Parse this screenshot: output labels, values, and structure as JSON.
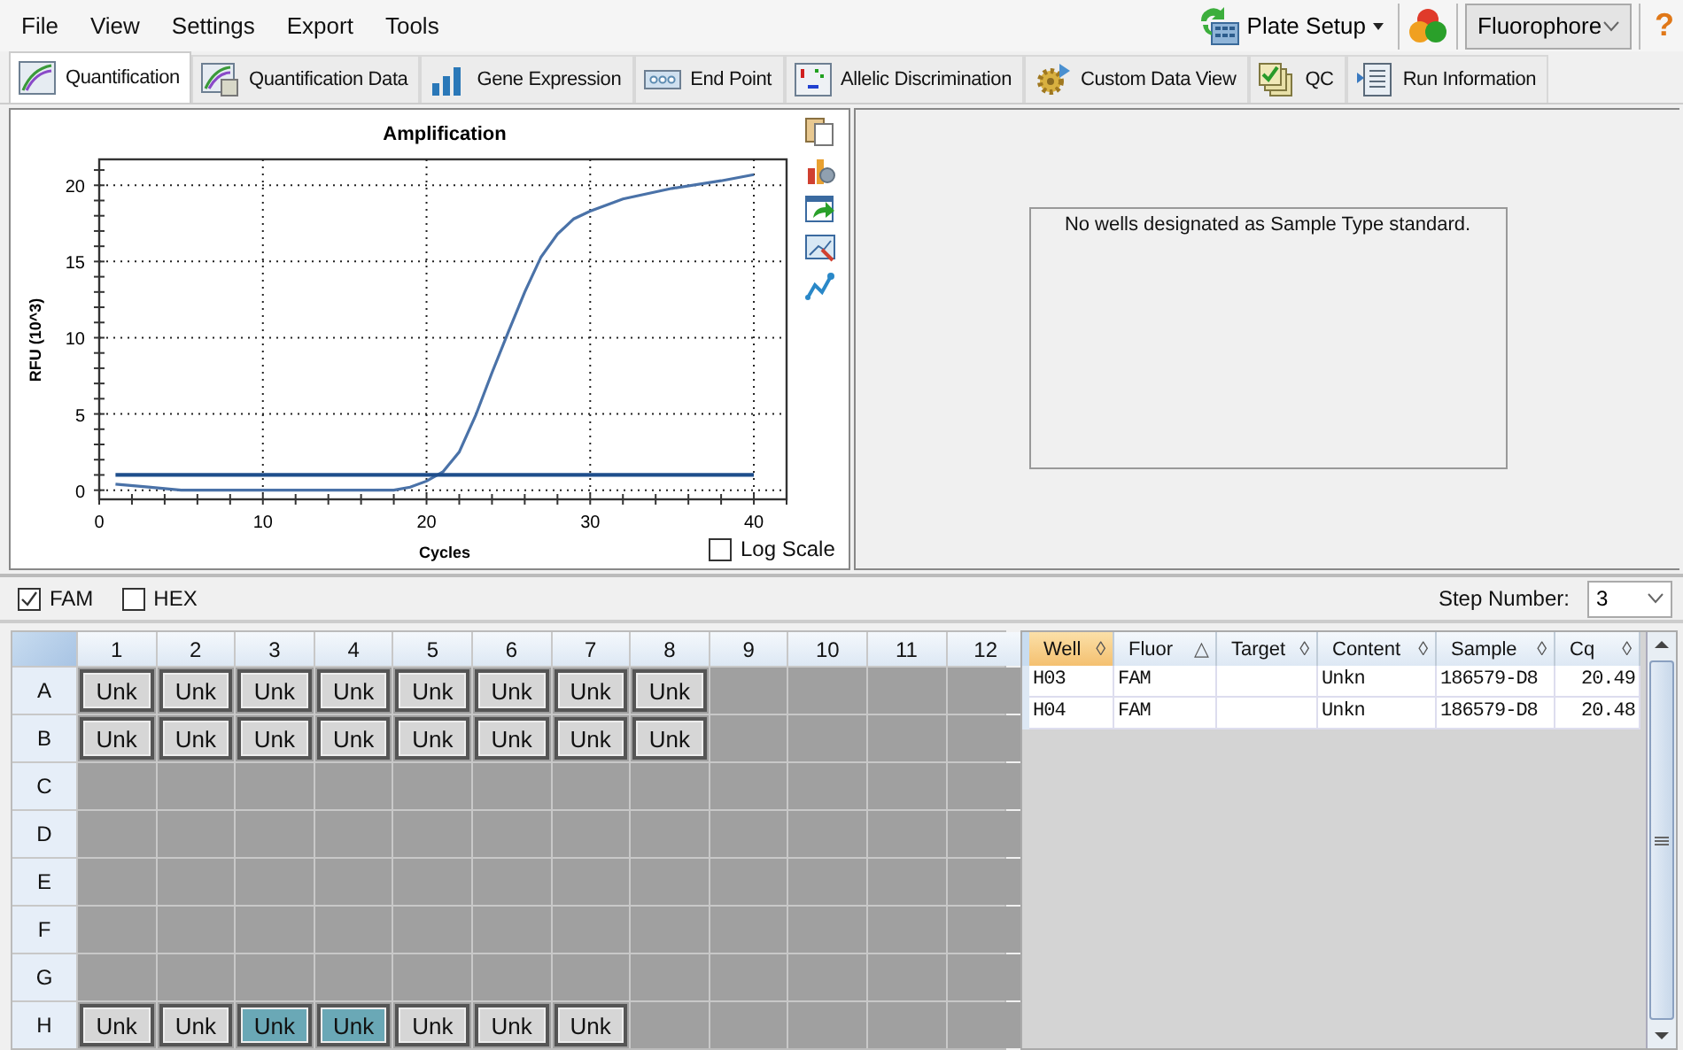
{
  "menu": [
    "File",
    "View",
    "Settings",
    "Export",
    "Tools"
  ],
  "toolbar": {
    "plate_setup": "Plate Setup",
    "view_select": "Fluorophore",
    "help": "?"
  },
  "tabs": [
    {
      "label": "Quantification",
      "selected": true
    },
    {
      "label": "Quantification Data",
      "selected": false
    },
    {
      "label": "Gene Expression",
      "selected": false
    },
    {
      "label": "End Point",
      "selected": false
    },
    {
      "label": "Allelic Discrimination",
      "selected": false
    },
    {
      "label": "Custom Data View",
      "selected": false
    },
    {
      "label": "QC",
      "selected": false
    },
    {
      "label": "Run Information",
      "selected": false
    }
  ],
  "amplification": {
    "log_scale_label": "Log Scale",
    "log_scale": false,
    "chart_data": {
      "type": "line",
      "title": "Amplification",
      "xlabel": "Cycles",
      "ylabel": "RFU (10^3)",
      "grid": true,
      "x": [
        1,
        3,
        5,
        10,
        15,
        17,
        18,
        19,
        20,
        21,
        22,
        23,
        24,
        25,
        26,
        27,
        28,
        29,
        30,
        32,
        35,
        38,
        40
      ],
      "series": [
        {
          "color": "#4a72a8",
          "values": [
            0.4,
            0.2,
            0,
            0,
            0,
            0,
            0,
            0.2,
            0.6,
            1.2,
            2.5,
            4.9,
            7.7,
            10.4,
            13.0,
            15.3,
            16.8,
            17.8,
            18.3,
            19.1,
            19.8,
            20.3,
            20.7
          ]
        },
        {
          "color": "#1f4e8c",
          "values": [
            1,
            1,
            1,
            1,
            1,
            1,
            1,
            1,
            1,
            1,
            1,
            1,
            1,
            1,
            1,
            1,
            1,
            1,
            1,
            1,
            1,
            1,
            1
          ]
        }
      ],
      "xlim": [
        0,
        42
      ],
      "ylim": [
        -0.6,
        21.7
      ],
      "xticks": [
        0,
        10,
        20,
        30,
        40
      ],
      "yticks": [
        0,
        5,
        10,
        15,
        20
      ]
    }
  },
  "standard_curve": {
    "message": "No wells designated as Sample Type standard."
  },
  "fluorophores": [
    {
      "label": "FAM",
      "checked": true
    },
    {
      "label": "HEX",
      "checked": false
    }
  ],
  "step": {
    "label": "Step Number:",
    "value": "3"
  },
  "plate": {
    "columns": [
      "1",
      "2",
      "3",
      "4",
      "5",
      "6",
      "7",
      "8",
      "9",
      "10",
      "11",
      "12"
    ],
    "rows": [
      {
        "label": "A",
        "wells": [
          {
            "kind": "sample",
            "label": "Unk",
            "selected": false
          },
          {
            "kind": "sample",
            "label": "Unk",
            "selected": false
          },
          {
            "kind": "sample",
            "label": "Unk",
            "selected": false
          },
          {
            "kind": "sample",
            "label": "Unk",
            "selected": false
          },
          {
            "kind": "sample",
            "label": "Unk",
            "selected": false
          },
          {
            "kind": "sample",
            "label": "Unk",
            "selected": false
          },
          {
            "kind": "sample",
            "label": "Unk",
            "selected": false
          },
          {
            "kind": "sample",
            "label": "Unk",
            "selected": false
          },
          {
            "kind": "empty"
          },
          {
            "kind": "empty"
          },
          {
            "kind": "empty"
          },
          {
            "kind": "empty"
          }
        ]
      },
      {
        "label": "B",
        "wells": [
          {
            "kind": "sample",
            "label": "Unk",
            "selected": false
          },
          {
            "kind": "sample",
            "label": "Unk",
            "selected": false
          },
          {
            "kind": "sample",
            "label": "Unk",
            "selected": false
          },
          {
            "kind": "sample",
            "label": "Unk",
            "selected": false
          },
          {
            "kind": "sample",
            "label": "Unk",
            "selected": false
          },
          {
            "kind": "sample",
            "label": "Unk",
            "selected": false
          },
          {
            "kind": "sample",
            "label": "Unk",
            "selected": false
          },
          {
            "kind": "sample",
            "label": "Unk",
            "selected": false
          },
          {
            "kind": "empty"
          },
          {
            "kind": "empty"
          },
          {
            "kind": "empty"
          },
          {
            "kind": "empty"
          }
        ]
      },
      {
        "label": "C",
        "wells": [
          {
            "kind": "empty"
          },
          {
            "kind": "empty"
          },
          {
            "kind": "empty"
          },
          {
            "kind": "empty"
          },
          {
            "kind": "empty"
          },
          {
            "kind": "empty"
          },
          {
            "kind": "empty"
          },
          {
            "kind": "empty"
          },
          {
            "kind": "empty"
          },
          {
            "kind": "empty"
          },
          {
            "kind": "empty"
          },
          {
            "kind": "empty"
          }
        ]
      },
      {
        "label": "D",
        "wells": [
          {
            "kind": "empty"
          },
          {
            "kind": "empty"
          },
          {
            "kind": "empty"
          },
          {
            "kind": "empty"
          },
          {
            "kind": "empty"
          },
          {
            "kind": "empty"
          },
          {
            "kind": "empty"
          },
          {
            "kind": "empty"
          },
          {
            "kind": "empty"
          },
          {
            "kind": "empty"
          },
          {
            "kind": "empty"
          },
          {
            "kind": "empty"
          }
        ]
      },
      {
        "label": "E",
        "wells": [
          {
            "kind": "empty"
          },
          {
            "kind": "empty"
          },
          {
            "kind": "empty"
          },
          {
            "kind": "empty"
          },
          {
            "kind": "empty"
          },
          {
            "kind": "empty"
          },
          {
            "kind": "empty"
          },
          {
            "kind": "empty"
          },
          {
            "kind": "empty"
          },
          {
            "kind": "empty"
          },
          {
            "kind": "empty"
          },
          {
            "kind": "empty"
          }
        ]
      },
      {
        "label": "F",
        "wells": [
          {
            "kind": "empty"
          },
          {
            "kind": "empty"
          },
          {
            "kind": "empty"
          },
          {
            "kind": "empty"
          },
          {
            "kind": "empty"
          },
          {
            "kind": "empty"
          },
          {
            "kind": "empty"
          },
          {
            "kind": "empty"
          },
          {
            "kind": "empty"
          },
          {
            "kind": "empty"
          },
          {
            "kind": "empty"
          },
          {
            "kind": "empty"
          }
        ]
      },
      {
        "label": "G",
        "wells": [
          {
            "kind": "empty"
          },
          {
            "kind": "empty"
          },
          {
            "kind": "empty"
          },
          {
            "kind": "empty"
          },
          {
            "kind": "empty"
          },
          {
            "kind": "empty"
          },
          {
            "kind": "empty"
          },
          {
            "kind": "empty"
          },
          {
            "kind": "empty"
          },
          {
            "kind": "empty"
          },
          {
            "kind": "empty"
          },
          {
            "kind": "empty"
          }
        ]
      },
      {
        "label": "H",
        "wells": [
          {
            "kind": "sample",
            "label": "Unk",
            "selected": false
          },
          {
            "kind": "sample",
            "label": "Unk",
            "selected": false
          },
          {
            "kind": "sample",
            "label": "Unk",
            "selected": true
          },
          {
            "kind": "sample",
            "label": "Unk",
            "selected": true
          },
          {
            "kind": "sample",
            "label": "Unk",
            "selected": false
          },
          {
            "kind": "sample",
            "label": "Unk",
            "selected": false
          },
          {
            "kind": "sample",
            "label": "Unk",
            "selected": false
          },
          {
            "kind": "empty"
          },
          {
            "kind": "empty"
          },
          {
            "kind": "empty"
          },
          {
            "kind": "empty"
          },
          {
            "kind": "empty"
          }
        ]
      }
    ]
  },
  "table": {
    "columns": [
      {
        "label": "Well",
        "sort_mark": "◊",
        "selected": true
      },
      {
        "label": "Fluor",
        "sort_mark": "△",
        "selected": false
      },
      {
        "label": "Target",
        "sort_mark": "◊",
        "selected": false
      },
      {
        "label": "Content",
        "sort_mark": "◊",
        "selected": false
      },
      {
        "label": "Sample",
        "sort_mark": "◊",
        "selected": false
      },
      {
        "label": "Cq",
        "sort_mark": "◊",
        "selected": false
      }
    ],
    "rows": [
      {
        "cells": [
          "H03",
          "FAM",
          null,
          "Unkn",
          "186579-D8",
          "20.49"
        ]
      },
      {
        "cells": [
          "H04",
          "FAM",
          null,
          "Unkn",
          "186579-D8",
          "20.48"
        ]
      }
    ]
  }
}
